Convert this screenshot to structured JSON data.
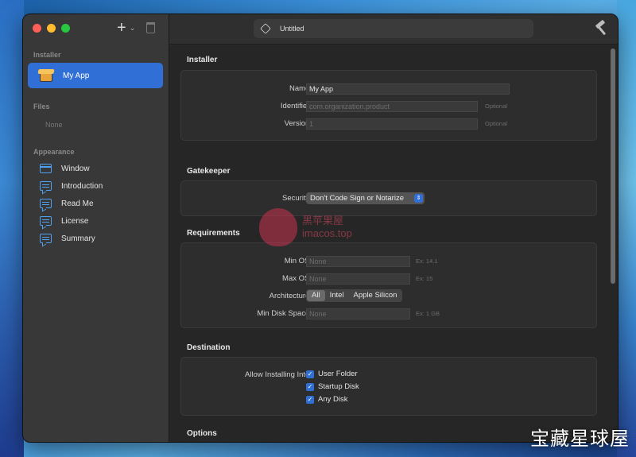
{
  "window": {
    "title": "Untitled"
  },
  "sidebar": {
    "installer_section": "Installer",
    "selected_item": "My App",
    "files_section": "Files",
    "files_empty": "None",
    "appearance_section": "Appearance",
    "items": [
      {
        "label": "Window",
        "icon": "window-icon"
      },
      {
        "label": "Introduction",
        "icon": "text-bubble-icon"
      },
      {
        "label": "Read Me",
        "icon": "text-bubble-icon"
      },
      {
        "label": "License",
        "icon": "text-bubble-icon"
      },
      {
        "label": "Summary",
        "icon": "text-bubble-icon"
      }
    ]
  },
  "installer": {
    "title": "Installer",
    "name_label": "Name:",
    "name_value": "My App",
    "identifier_label": "Identifier:",
    "identifier_placeholder": "com.organization.product",
    "identifier_hint": "Optional",
    "version_label": "Version:",
    "version_placeholder": "1",
    "version_hint": "Optional"
  },
  "gatekeeper": {
    "title": "Gatekeeper",
    "security_label": "Security:",
    "security_value": "Don't Code Sign or Notarize"
  },
  "requirements": {
    "title": "Requirements",
    "min_os_label": "Min OS:",
    "min_os_placeholder": "None",
    "min_os_hint": "Ex: 14.1",
    "max_os_label": "Max OS:",
    "max_os_placeholder": "None",
    "max_os_hint": "Ex: 15",
    "architecture_label": "Architecture:",
    "architecture_options": [
      "All",
      "Intel",
      "Apple Silicon"
    ],
    "architecture_selected": "All",
    "disk_label": "Min Disk Space:",
    "disk_placeholder": "None",
    "disk_hint": "Ex: 1 GB"
  },
  "destination": {
    "title": "Destination",
    "allow_label": "Allow Installing Into:",
    "options": [
      "User Folder",
      "Startup Disk",
      "Any Disk"
    ]
  },
  "options": {
    "title": "Options"
  },
  "watermarks": {
    "bottom": "宝藏星球屋",
    "mid_line1": "黑苹果屋",
    "mid_line2": "imacos.top"
  },
  "colors": {
    "accent": "#2f6fd6",
    "sidebar": "#383838",
    "content": "#262626"
  }
}
